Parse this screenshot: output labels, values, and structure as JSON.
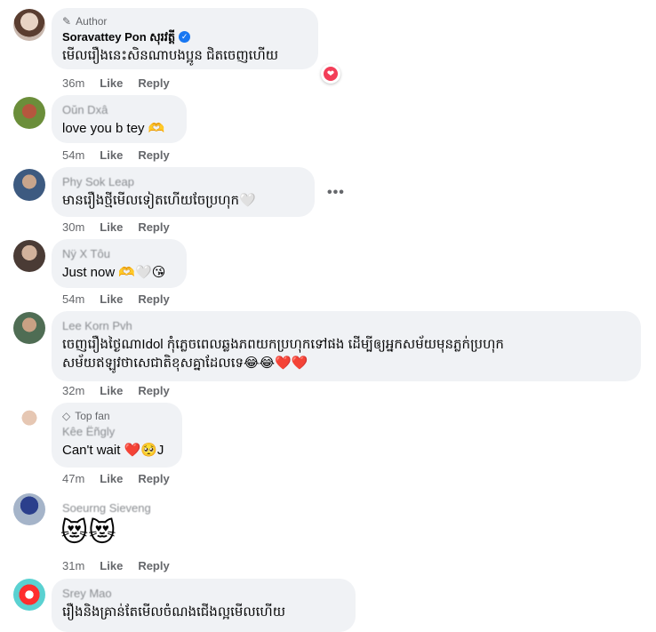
{
  "colors": {
    "heart": "#f33e58",
    "verified": "#1877f2",
    "bubble": "#f0f2f5",
    "meta": "#65676b"
  },
  "comments": [
    {
      "badge": "Author",
      "badge_icon": "pencil-icon",
      "name": "Soravattey Pon សុរវត្តី",
      "verified": true,
      "text": "មើលរឿងនេះសិនណាបងប្អូន ជិតចេញហើយ",
      "reaction": "heart",
      "time": "36m",
      "like": "Like",
      "reply": "Reply"
    },
    {
      "name": "Oŭn Dxâ",
      "text": "love you b tey 🫶",
      "time": "54m",
      "like": "Like",
      "reply": "Reply"
    },
    {
      "name": "Phy Sok Leap",
      "text": "មានរឿងថ្មីមើលទៀតហើយចែប្រហុក🤍",
      "more": "•••",
      "time": "30m",
      "like": "Like",
      "reply": "Reply"
    },
    {
      "name": "Nÿ X Tôu",
      "text": "Just now 🫶🤍😘",
      "time": "54m",
      "like": "Like",
      "reply": "Reply"
    },
    {
      "name": "Lee Korn Pvh",
      "text_line1": "ចេញរឿងថ្ងៃណាIdol កុំភ្លេចពេលឆ្លងភពយកប្រហុកទៅផង ដើម្បីឲ្យអ្នកសម័យមុនភ្លក់ប្រហុក",
      "text_line2": "សម័យឥឡូវថាសេជាតិខុសគ្នាដែលទេ😂😂❤️❤️",
      "time": "32m",
      "like": "Like",
      "reply": "Reply"
    },
    {
      "badge": "Top fan",
      "badge_icon": "diamond-icon",
      "name": "Kêe Ëñgly",
      "text": "Can't wait ❤️🥺J",
      "time": "47m",
      "like": "Like",
      "reply": "Reply"
    },
    {
      "name": "Soeurng Sieveng",
      "text": "😻😻",
      "time": "31m",
      "like": "Like",
      "reply": "Reply"
    },
    {
      "name": "Srey Mao",
      "text": "រឿងនិងគ្រាន់តែមើលចំណងជើងល្អមើលហើយ"
    }
  ]
}
